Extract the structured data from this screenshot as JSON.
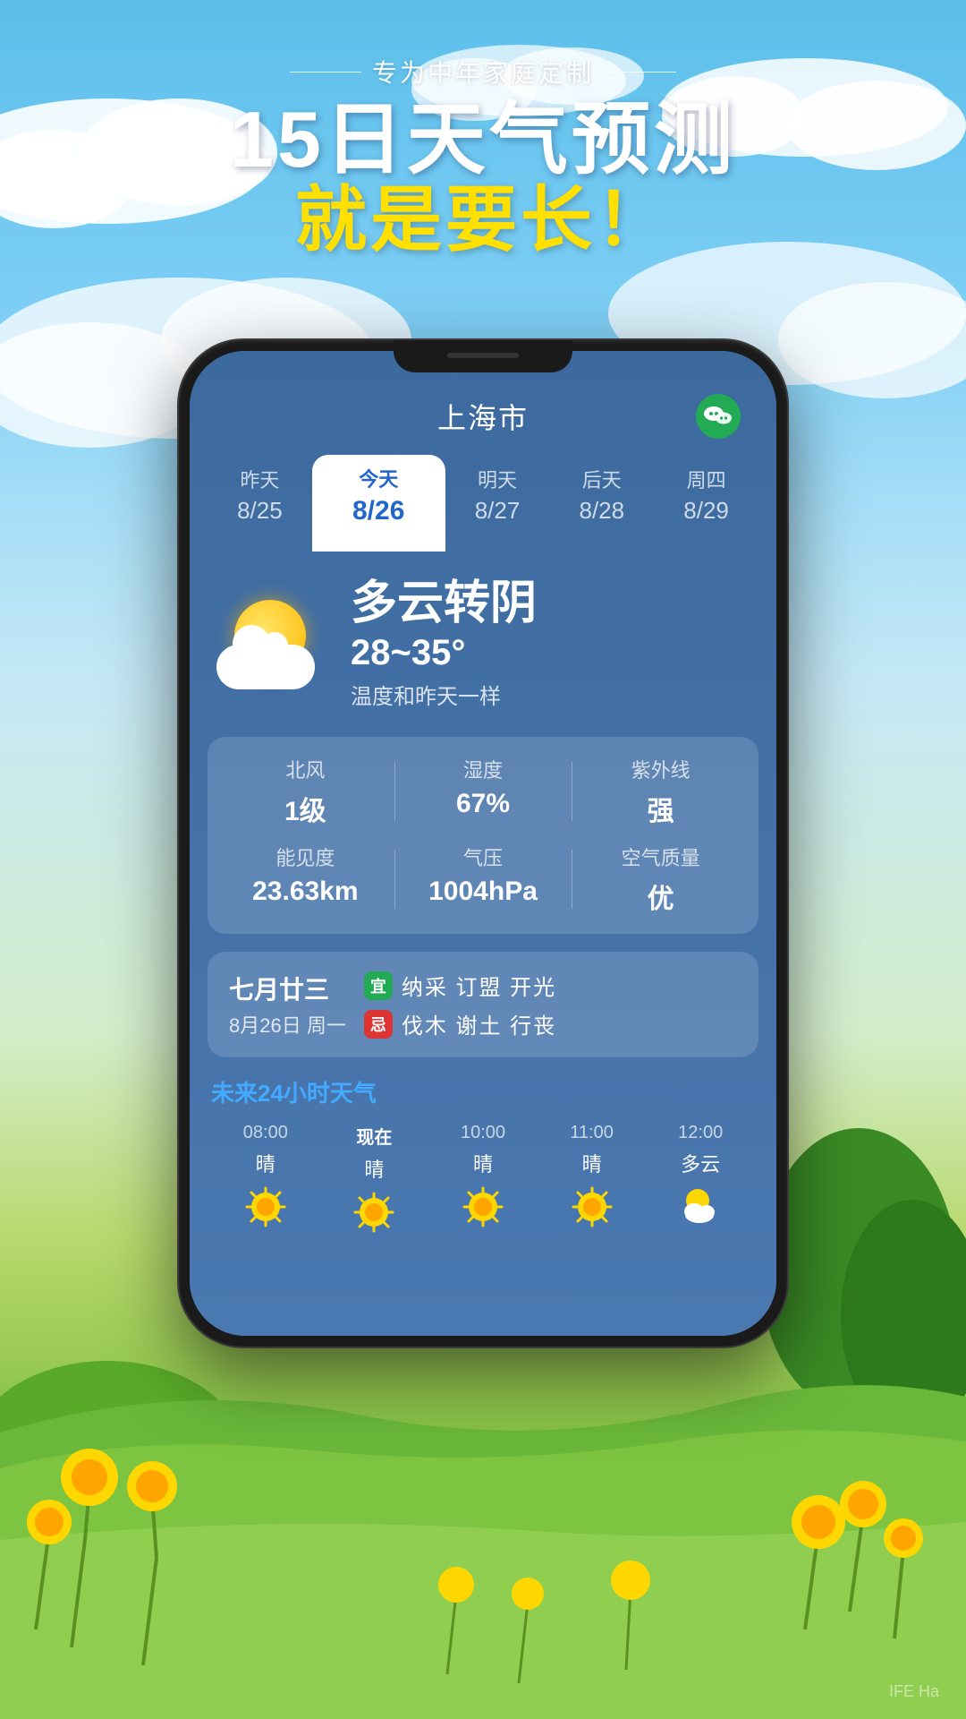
{
  "background": {
    "skyColor": "#5bbfea",
    "grassColor": "#6ab83a"
  },
  "header": {
    "subtitle": "专为中年家庭定制",
    "main_title": "15日天气预测",
    "sub_title": "就是要长！"
  },
  "phone": {
    "city": "上海市",
    "days": [
      {
        "label": "昨天",
        "date": "8/25",
        "active": false
      },
      {
        "label": "今天",
        "date": "8/26",
        "active": true
      },
      {
        "label": "明天",
        "date": "8/27",
        "active": false
      },
      {
        "label": "后天",
        "date": "8/28",
        "active": false
      },
      {
        "label": "周四",
        "date": "8/29",
        "active": false
      }
    ],
    "weather": {
      "description": "多云转阴",
      "temp_range": "28~35°",
      "note": "温度和昨天一样"
    },
    "details": [
      {
        "label": "北风",
        "value": "1级"
      },
      {
        "label": "湿度",
        "value": "67%"
      },
      {
        "label": "紫外线",
        "value": "强"
      },
      {
        "label": "能见度",
        "value": "23.63km"
      },
      {
        "label": "气压",
        "value": "1004hPa"
      },
      {
        "label": "空气质量",
        "value": "优"
      }
    ],
    "calendar": {
      "lunar": "七月廿三",
      "solar": "8月26日 周一",
      "good_badge": "宜",
      "good_items": "纳采 订盟 开光",
      "bad_badge": "忌",
      "bad_items": "伐木 谢土 行丧"
    },
    "forecast": {
      "title": "未来24小时天气",
      "items": [
        {
          "time": "08:00",
          "desc": "晴",
          "icon": "sun"
        },
        {
          "time": "现在",
          "desc": "晴",
          "icon": "sun"
        },
        {
          "time": "10:00",
          "desc": "晴",
          "icon": "sun"
        },
        {
          "time": "11:00",
          "desc": "晴",
          "icon": "sun"
        },
        {
          "time": "12:00",
          "desc": "多云",
          "icon": "partly-cloudy"
        }
      ]
    }
  },
  "watermark": "IFE Ha"
}
